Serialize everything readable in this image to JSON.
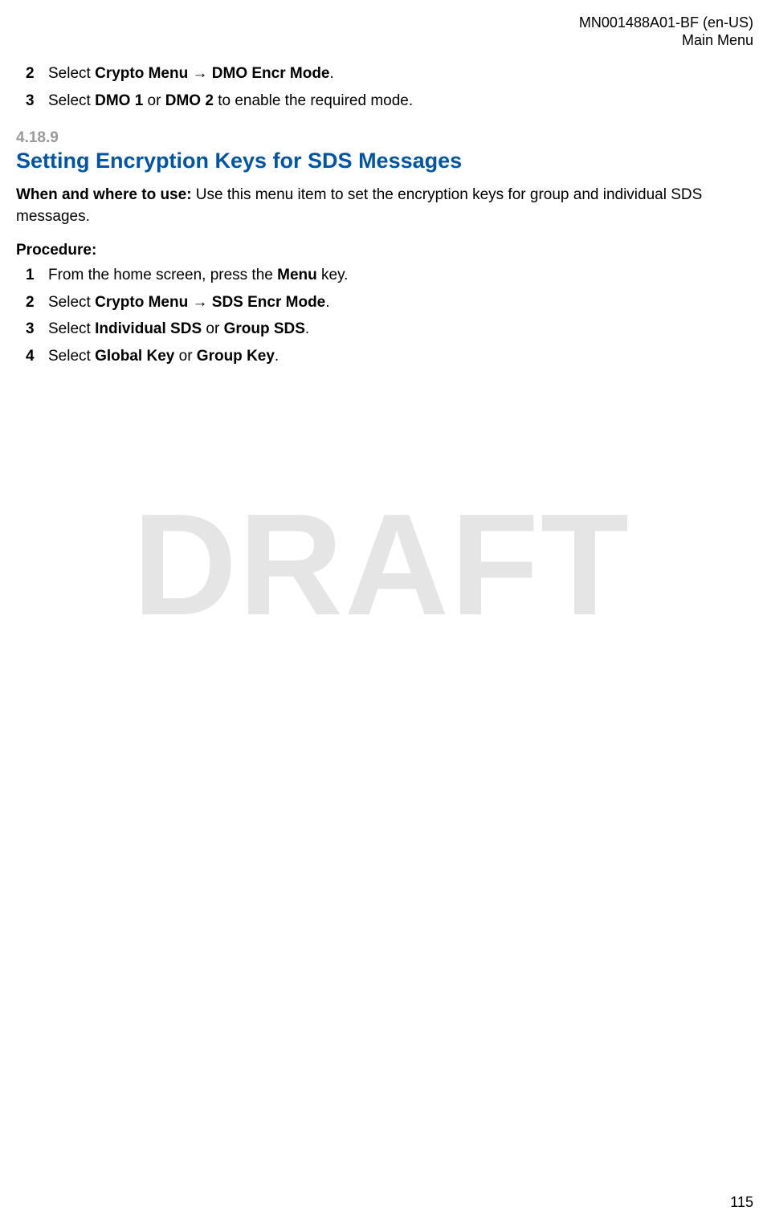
{
  "header": {
    "doc_id": "MN001488A01-BF (en-US)",
    "section_path": "Main Menu"
  },
  "top_steps": [
    {
      "n": "2",
      "pre": "Select ",
      "b1": "Crypto Menu",
      "mid": " → ",
      "b2": "DMO Encr Mode",
      "post": "."
    },
    {
      "n": "3",
      "pre": "Select ",
      "b1": "DMO 1",
      "mid": " or ",
      "b2": "DMO 2",
      "post": " to enable the required mode."
    }
  ],
  "section": {
    "number": "4.18.9",
    "title": "Setting Encryption Keys for SDS Messages",
    "when_label": "When and where to use:",
    "when_text": " Use this menu item to set the encryption keys for group and individual SDS messages.",
    "procedure_label": "Procedure:",
    "steps": [
      {
        "n": "1",
        "pre": "From the home screen, press the ",
        "b1": "Menu",
        "mid": "",
        "b2": "",
        "post": " key."
      },
      {
        "n": "2",
        "pre": "Select ",
        "b1": "Crypto Menu",
        "mid": " → ",
        "b2": "SDS Encr Mode",
        "post": "."
      },
      {
        "n": "3",
        "pre": "Select ",
        "b1": "Individual SDS",
        "mid": " or ",
        "b2": "Group SDS",
        "post": "."
      },
      {
        "n": "4",
        "pre": "Select ",
        "b1": "Global Key",
        "mid": " or ",
        "b2": "Group Key",
        "post": "."
      }
    ]
  },
  "watermark": "DRAFT",
  "page_number": "115"
}
